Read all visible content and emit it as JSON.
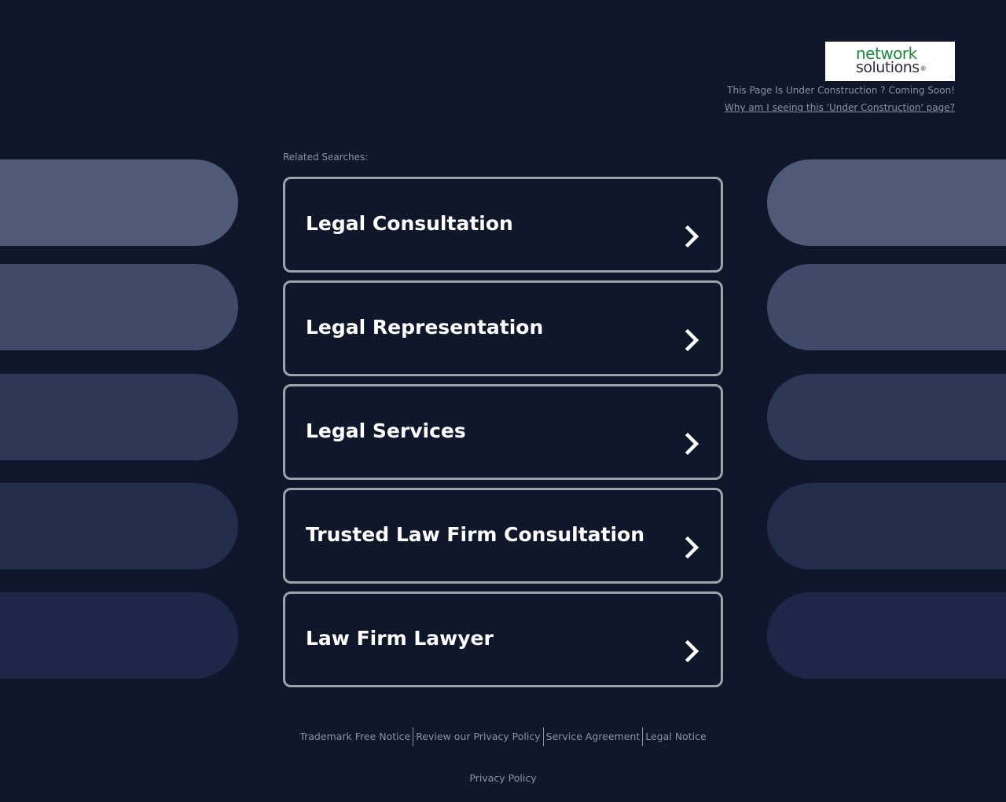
{
  "header": {
    "logo_line1": "network",
    "logo_line2": "solutions",
    "logo_reg": "®",
    "construction_text": "This Page Is Under Construction ? Coming Soon!",
    "why_link": "Why am I seeing this 'Under Construction' page?"
  },
  "related": {
    "label": "Related Searches:",
    "items": [
      {
        "label": "Legal Consultation"
      },
      {
        "label": "Legal Representation"
      },
      {
        "label": "Legal Services"
      },
      {
        "label": "Trusted Law Firm Consultation"
      },
      {
        "label": "Law Firm Lawyer"
      }
    ]
  },
  "footer": {
    "links": [
      "Trademark Free Notice",
      "Review our Privacy Policy",
      "Service Agreement",
      "Legal Notice"
    ],
    "privacy_policy": "Privacy Policy"
  },
  "colors": {
    "background": "#11172b",
    "item_border": "#9fa2a8",
    "text_muted": "#8b92a3",
    "logo_green": "#1a8a3a"
  }
}
